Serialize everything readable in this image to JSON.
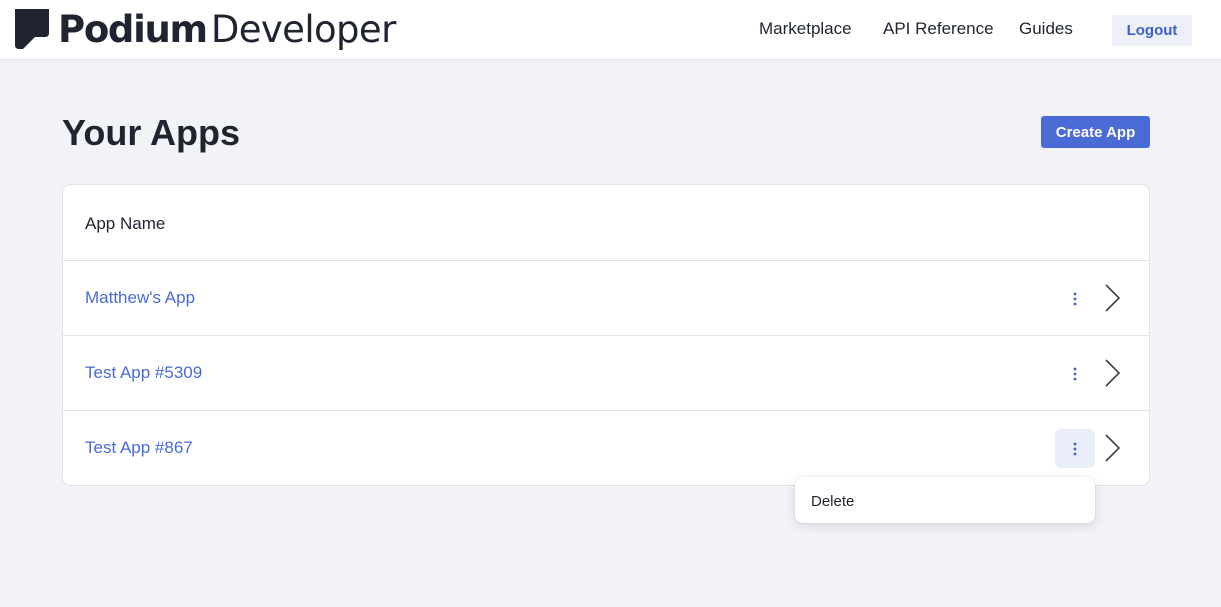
{
  "header": {
    "brand": "Podium",
    "brand_sub": "Developer",
    "logo_icon": "podium-logo-icon",
    "nav": [
      {
        "label": "Marketplace"
      },
      {
        "label": "API Reference"
      },
      {
        "label": "Guides"
      }
    ],
    "logout_label": "Logout"
  },
  "main": {
    "title": "Your Apps",
    "create_label": "Create App",
    "column_header": "App Name",
    "apps": [
      {
        "name": "Matthew's App"
      },
      {
        "name": "Test App #5309"
      },
      {
        "name": "Test App #867"
      }
    ]
  },
  "context_menu": {
    "items": [
      {
        "label": "Delete"
      }
    ]
  },
  "colors": {
    "accent": "#4a6bd6",
    "background": "#f2f3f7",
    "text": "#1f2430"
  }
}
